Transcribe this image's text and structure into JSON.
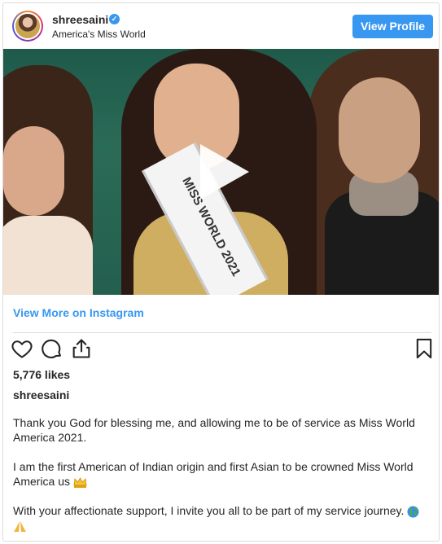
{
  "header": {
    "username": "shreesaini",
    "verified_glyph": "✓",
    "subtitle": "America's Miss World",
    "view_profile_label": "View Profile"
  },
  "media": {
    "sash_text": "MISS WORLD 2021"
  },
  "links": {
    "view_more": "View More on Instagram"
  },
  "stats": {
    "likes": "5,776 likes"
  },
  "caption": {
    "username": "shreesaini",
    "paragraph1": "Thank you God for blessing me, and allowing me to be of service as Miss World America 2021.",
    "paragraph2": "I am the first American of Indian origin and first Asian to be crowned Miss World America us",
    "paragraph3": "With your affectionate support, I invite you all to be part of my service journey."
  },
  "icons": {
    "like": "heart-icon",
    "comment": "comment-icon",
    "share": "share-icon",
    "save": "bookmark-icon",
    "crown": "crown-emoji",
    "globe": "globe-emoji",
    "pray": "pray-emoji"
  },
  "colors": {
    "accent": "#3897f0",
    "text": "#262626",
    "border": "#dbdbdb"
  }
}
